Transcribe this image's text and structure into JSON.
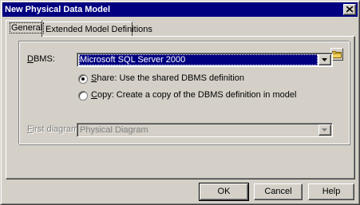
{
  "window": {
    "title": "New Physical Data Model"
  },
  "tabs": [
    {
      "label": "General",
      "active": true
    },
    {
      "label": "Extended Model Definitions",
      "active": false
    }
  ],
  "dbms": {
    "label_prefix": "D",
    "label_rest": "BMS:",
    "value": "Microsoft SQL Server 2000",
    "folder_icon": "folder-icon"
  },
  "options": {
    "share": {
      "prefix": "S",
      "rest": "hare: Use the shared DBMS definition",
      "checked": true
    },
    "copy": {
      "prefix": "C",
      "rest": "opy: Create a copy of the DBMS definition in model",
      "checked": false
    }
  },
  "first_diagram": {
    "label_prefix": "F",
    "label_rest": "irst diagram:",
    "value": "Physical Diagram",
    "enabled": false
  },
  "buttons": {
    "ok": "OK",
    "cancel": "Cancel",
    "help": "Help"
  }
}
